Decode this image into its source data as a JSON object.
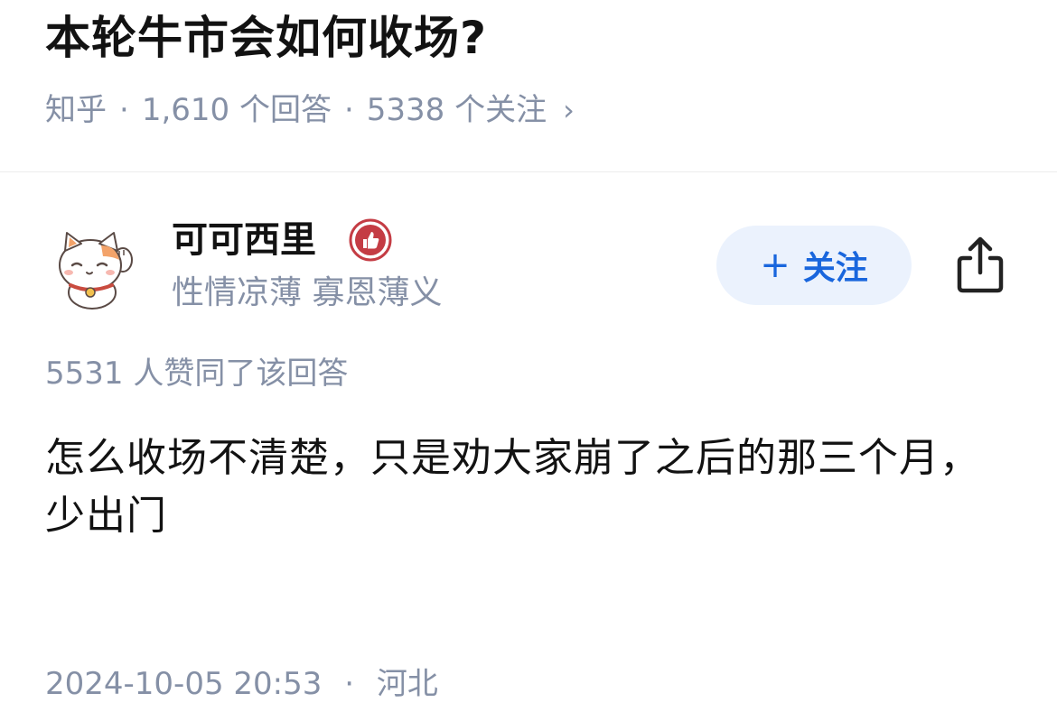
{
  "question": {
    "title": "本轮牛市会如何收场?",
    "source": "知乎",
    "answers": "1,610 个回答",
    "followers": "5338 个关注",
    "chevron": "›",
    "separator": "·"
  },
  "author": {
    "name": "可可西里",
    "bio": "性情凉薄 寡恩薄义",
    "avatar_icon": "lucky-cat-avatar",
    "badge_icon": "thumbs-up-badge-icon"
  },
  "follow_button": {
    "plus": "+",
    "label": "关注"
  },
  "share_icon": "share-icon",
  "answer": {
    "votes": "5531 人赞同了该回答",
    "content": "怎么收场不清楚，只是劝大家崩了之后的那三个月，少出门",
    "date": "2024-10-05 20:53",
    "separator": "·",
    "location": "河北"
  },
  "colors": {
    "muted": "#8590a6",
    "accent_blue": "#1966dd",
    "follow_bg": "#ebf2fd",
    "badge_red": "#c43c44"
  }
}
